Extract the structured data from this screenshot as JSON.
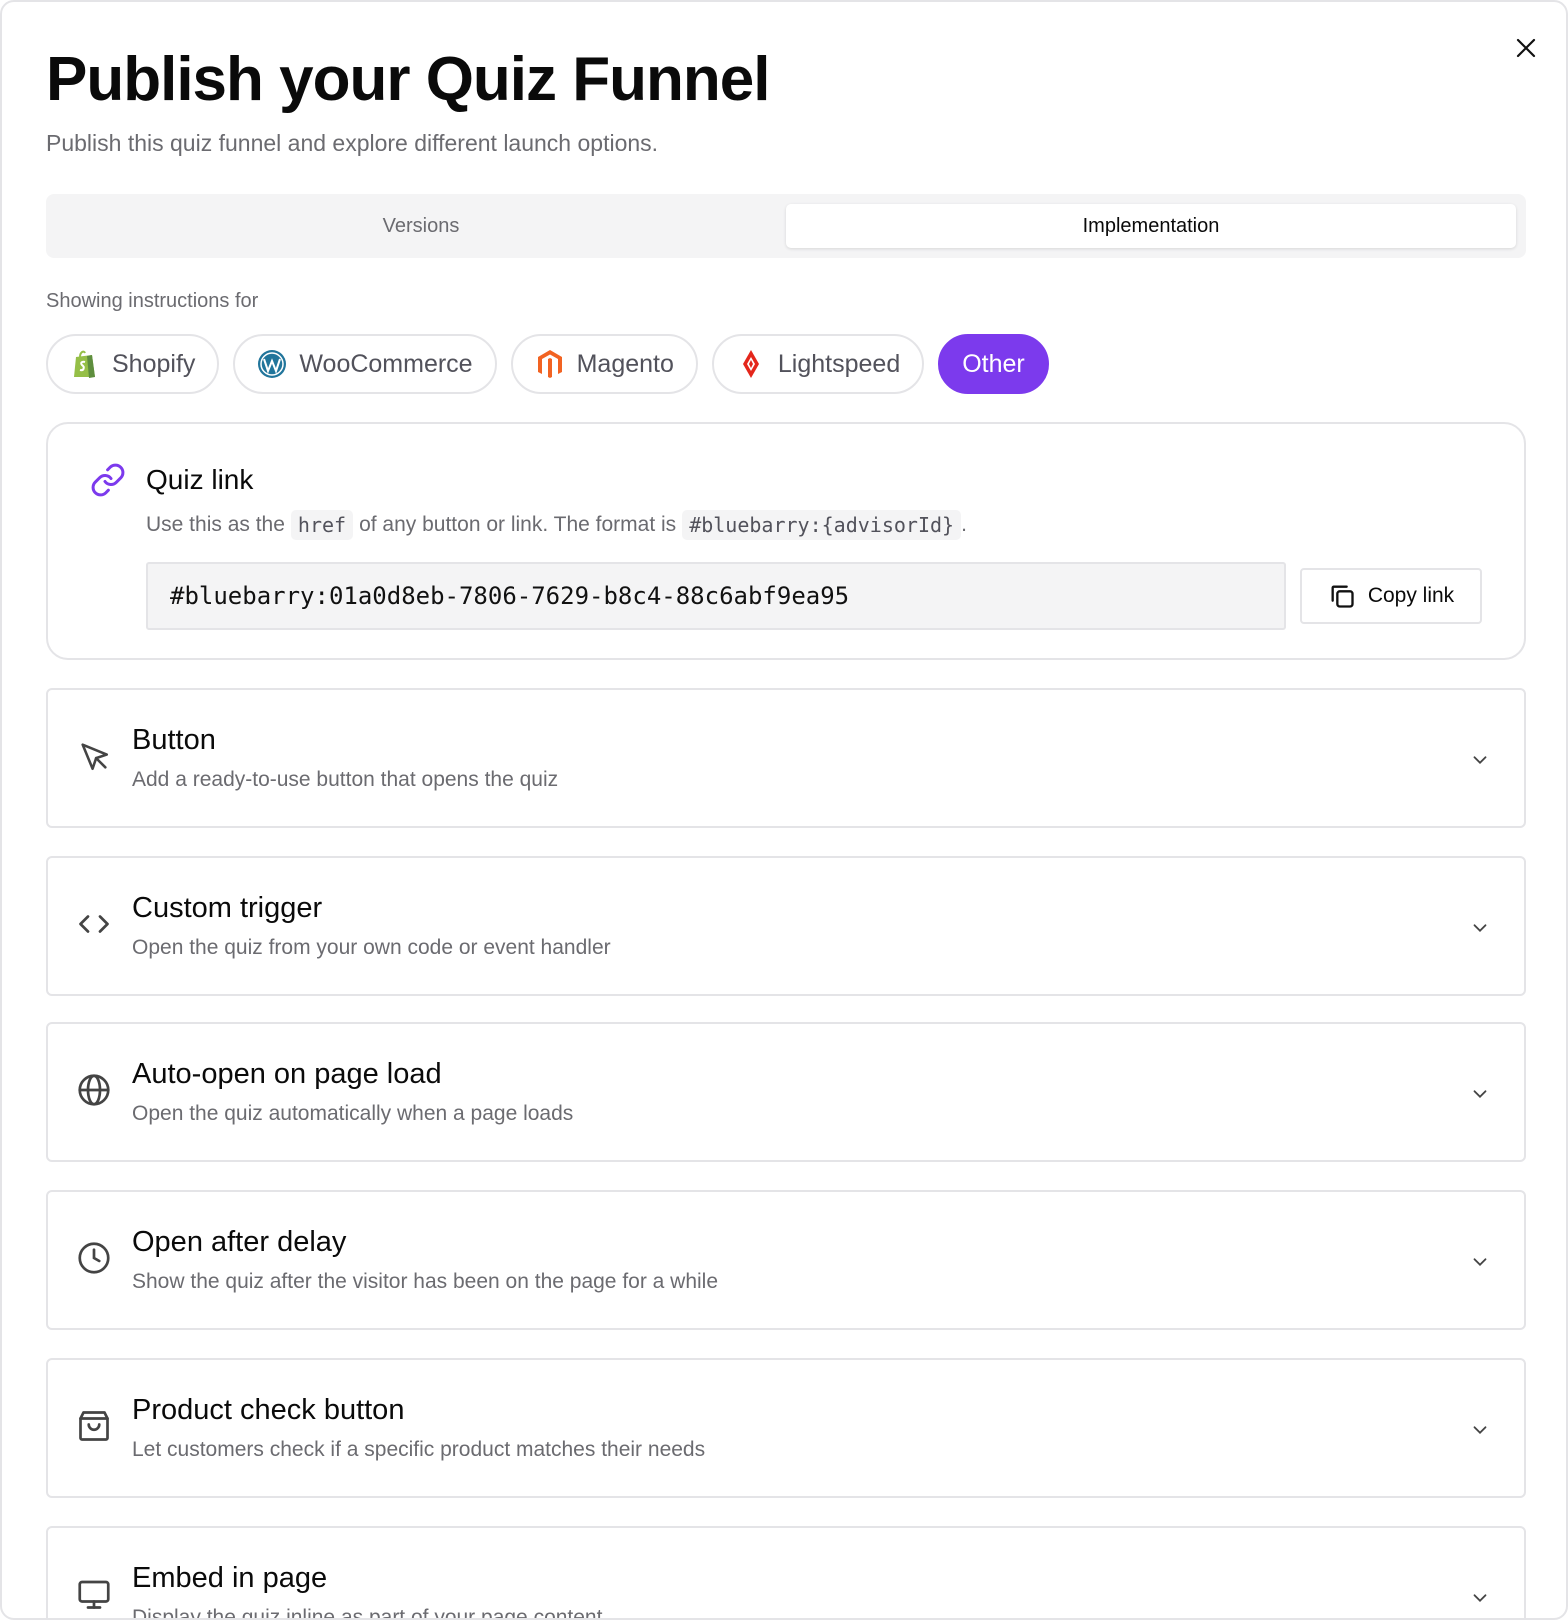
{
  "dialog": {
    "title": "Publish your Quiz Funnel",
    "subtitle": "Publish this quiz funnel and explore different launch options."
  },
  "tabs": [
    {
      "label": "Versions",
      "active": false
    },
    {
      "label": "Implementation",
      "active": true
    }
  ],
  "platform_section": {
    "label": "Showing instructions for",
    "platforms": [
      {
        "label": "Shopify",
        "icon": "shopify-icon",
        "active": false
      },
      {
        "label": "WooCommerce",
        "icon": "wordpress-icon",
        "active": false
      },
      {
        "label": "Magento",
        "icon": "magento-icon",
        "active": false
      },
      {
        "label": "Lightspeed",
        "icon": "lightspeed-icon",
        "active": false
      },
      {
        "label": "Other",
        "icon": "",
        "active": true
      }
    ]
  },
  "quiz_link": {
    "title": "Quiz link",
    "desc_prefix": "Use this as the",
    "desc_code1": "href",
    "desc_middle": "of any button or link. The format is",
    "desc_code2": "#bluebarry:{advisorId}",
    "desc_suffix": ".",
    "value": "#bluebarry:01a0d8eb-7806-7629-b8c4-88c6abf9ea95",
    "copy_label": "Copy link"
  },
  "options": [
    {
      "title": "Button",
      "desc": "Add a ready-to-use button that opens the quiz",
      "icon": "cursor-icon"
    },
    {
      "title": "Custom trigger",
      "desc": "Open the quiz from your own code or event handler",
      "icon": "code-icon"
    },
    {
      "title": "Auto-open on page load",
      "desc": "Open the quiz automatically when a page loads",
      "icon": "globe-icon"
    },
    {
      "title": "Open after delay",
      "desc": "Show the quiz after the visitor has been on the page for a while",
      "icon": "clock-icon"
    },
    {
      "title": "Product check button",
      "desc": "Let customers check if a specific product matches their needs",
      "icon": "shopping-bag-icon"
    },
    {
      "title": "Embed in page",
      "desc": "Display the quiz inline as part of your page content",
      "icon": "monitor-icon"
    }
  ],
  "colors": {
    "accent": "#7c3aed",
    "border": "#e4e4e7",
    "muted_text": "#6b6b70"
  }
}
